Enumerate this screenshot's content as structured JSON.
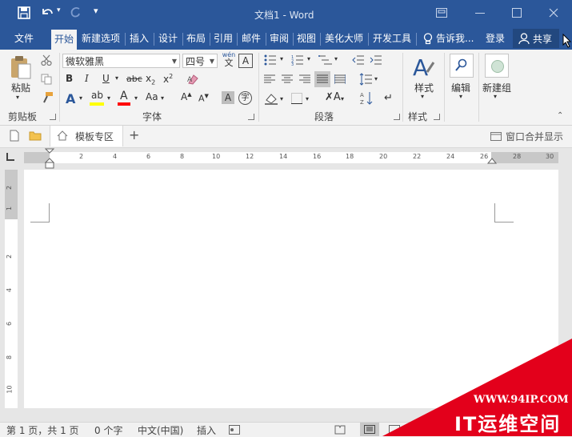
{
  "window": {
    "title": "文档1 - Word"
  },
  "tabs": [
    "文件",
    "开始",
    "新建选项",
    "插入",
    "设计",
    "布局",
    "引用",
    "邮件",
    "审阅",
    "视图",
    "美化大师",
    "开发工具"
  ],
  "tell_me": "告诉我...",
  "login": "登录",
  "share": "共享",
  "clipboard": {
    "paste": "粘贴",
    "group": "剪贴板"
  },
  "font": {
    "name": "微软雅黑",
    "size": "四号",
    "group": "字体",
    "phonetic": "wén",
    "phonetic_char": "文"
  },
  "paragraph": {
    "group": "段落"
  },
  "styles": {
    "label": "样式",
    "group": "样式"
  },
  "editing": {
    "label": "编辑"
  },
  "newgroup": {
    "label": "新建组"
  },
  "doc_tabs": {
    "template": "模板专区",
    "merge": "窗口合并显示"
  },
  "ruler_h": [
    "2",
    "4",
    "6",
    "8",
    "10",
    "12",
    "14",
    "16",
    "18",
    "20",
    "22",
    "24",
    "26",
    "28",
    "30"
  ],
  "ruler_v": [
    "2",
    "1",
    "2",
    "4",
    "6",
    "8",
    "10"
  ],
  "status": {
    "page": "第 1 页，共 1 页",
    "words": "0 个字",
    "lang": "中文(中国)",
    "mode": "插入"
  },
  "watermark": {
    "url": "WWW.94IP.COM",
    "brand": "IT运维空间",
    "color": "#e3001b"
  },
  "colors": {
    "accent": "#2b579a",
    "highlight": "#ffff00",
    "fontcolor": "#ff0000"
  }
}
